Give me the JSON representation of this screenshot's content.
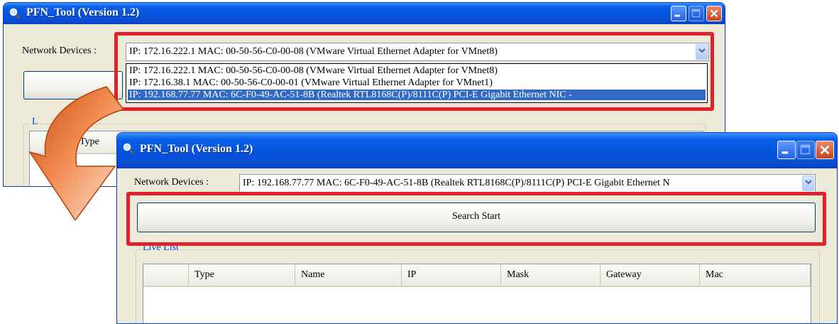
{
  "back_window": {
    "title": "PFN_Tool (Version 1.2)",
    "network_label": "Network Devices :",
    "combo_value": "IP: 172.16.222.1  MAC: 00-50-56-C0-00-08 (VMware Virtual Ethernet Adapter for VMnet8)",
    "dropdown_items": [
      "IP: 172.16.222.1  MAC: 00-50-56-C0-00-08 (VMware Virtual Ethernet Adapter for VMnet8)",
      "IP: 172.16.38.1  MAC: 00-50-56-C0-00-01 (VMware Virtual Ethernet Adapter for VMnet1)",
      "IP: 192.168.77.77  MAC: 6C-F0-49-AC-51-8B (Realtek RTL8168C(P)/8111C(P) PCI-E Gigabit Ethernet NIC -"
    ],
    "selected_index": 2,
    "group_title_partial": "L",
    "col_type": "Type"
  },
  "front_window": {
    "title": "PFN_Tool (Version 1.2)",
    "network_label": "Network Devices :",
    "combo_value": "IP: 192.168.77.77  MAC: 6C-F0-49-AC-51-8B (Realtek RTL8168C(P)/8111C(P) PCI-E Gigabit Ethernet N",
    "search_button": "Search Start",
    "live_list_title": "Live List",
    "columns": [
      "",
      "Type",
      "Name",
      "IP",
      "Mask",
      "Gateway",
      "Mac"
    ]
  },
  "colors": {
    "highlight": "#e0222a",
    "title_bar": "#0653dc",
    "selection": "#316ac5",
    "arrow": "#e8601c"
  },
  "icons": [
    "magnifier-icon",
    "minimize-icon",
    "maximize-icon",
    "close-icon",
    "chevron-down-icon",
    "curved-arrow-icon"
  ]
}
